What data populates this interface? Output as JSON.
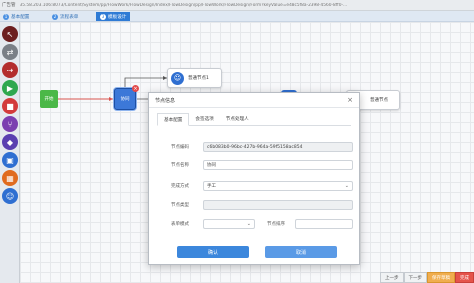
{
  "browser": {
    "page_name": "广告管",
    "url": "35.58.203.106:8073/Content/System/pp/FlowWork/FlowDesign/Index/FlowDesign/pp/FlowWork/FlowDesign/Form?keyValue=e48c5f8a-2398-4560-8ff0-..."
  },
  "steps": [
    {
      "num": "1",
      "label": "基本配置"
    },
    {
      "num": "2",
      "label": "流程表单"
    },
    {
      "num": "3",
      "label": "模板设计"
    }
  ],
  "toolbar": {
    "tools": [
      {
        "icon": "pointer-icon",
        "color": "#6c1f1f"
      },
      {
        "icon": "connect-icon",
        "color": "#7a7f86"
      },
      {
        "icon": "dashed-connect-icon",
        "color": "#b32d2d"
      },
      {
        "icon": "start-icon",
        "color": "#2fa84f"
      },
      {
        "icon": "stop-icon",
        "color": "#d33b3b"
      },
      {
        "icon": "branch-icon",
        "color": "#7b3fb0"
      },
      {
        "icon": "merge-icon",
        "color": "#5a3fb0"
      },
      {
        "icon": "node-icon",
        "color": "#2f6fd1"
      },
      {
        "icon": "module-icon",
        "color": "#e06b1f"
      },
      {
        "icon": "user-icon",
        "color": "#2f6fd1"
      }
    ]
  },
  "canvas": {
    "start_label": "开始",
    "selected_label": "协同",
    "task1_label": "普通节点1",
    "task2_label": "普通节点"
  },
  "dialog": {
    "title": "节点信息",
    "tabs": [
      "基本配置",
      "会签选项",
      "节点处理人"
    ],
    "fields": {
      "node_code_label": "节点编码",
      "node_code_value": "c6b083b0-96bc-427b-964a-59f5158ac854",
      "node_name_label": "节点名称",
      "node_name_value": "协同",
      "finish_mode_label": "完成方式",
      "finish_mode_value": "手工",
      "node_type_label": "节点类型",
      "node_type_value": "",
      "form_type_label": "表单模式",
      "form_type_value": "",
      "node_order_label": "节点排序",
      "node_order_value": ""
    },
    "ok_label": "确认",
    "cancel_label": "取消"
  },
  "bottom": {
    "prev": "上一步",
    "next": "下一步",
    "save_draft": "保存草稿",
    "finish": "完成"
  }
}
